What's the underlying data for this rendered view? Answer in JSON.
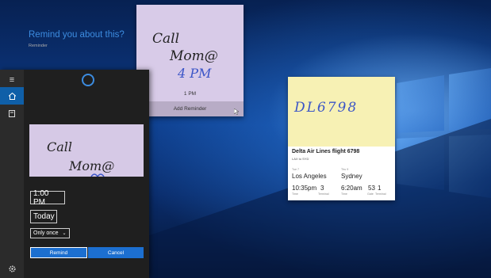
{
  "cortana": {
    "title": "Remind you about this?",
    "subtitle": "Reminder",
    "note_handwriting": [
      "Call",
      "Mom@"
    ],
    "time": "1:00 PM",
    "day": "Today",
    "repeat": "Only once",
    "remind_label": "Remind",
    "cancel_label": "Cancel"
  },
  "note_purple": {
    "handwriting": [
      "Call",
      "Mom@",
      "4 PM"
    ],
    "time_label": "1 PM",
    "add_reminder_label": "Add Reminder"
  },
  "note_yellow": {
    "handwriting": "DL6798",
    "flight_title": "Delta Air Lines flight 6798",
    "route": "LAX to SYD",
    "from_label": "Tue 7",
    "to_label": "Thu 9",
    "from_city": "Los Angeles",
    "to_city": "Sydney",
    "dep_time": "10:35pm",
    "dep_terminal": "3",
    "arr_time": "6:20am",
    "arr_gate": "53",
    "arr_terminal": "1",
    "dep_time_caption": "Time",
    "dep_terminal_caption": "Terminal",
    "arr_time_caption": "Time",
    "arr_gate_caption": "Gate",
    "arr_terminal_caption": "Terminal"
  },
  "colors": {
    "accent": "#1c6fd0",
    "cortana_blue": "#3c8ce0",
    "ink_blue": "#3b55c7",
    "purple_note": "#d8cbe8",
    "yellow_note": "#f7f1b4"
  }
}
